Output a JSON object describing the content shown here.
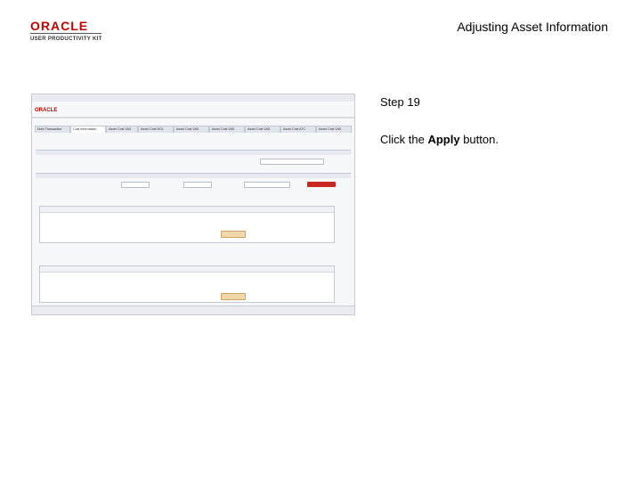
{
  "header": {
    "logo_word": "ORACLE",
    "logo_sub": "USER PRODUCTIVITY KIT",
    "title": "Adjusting Asset Information"
  },
  "step": {
    "label": "Step 19",
    "instruction_prefix": "Click the ",
    "instruction_bold": "Apply",
    "instruction_suffix": " button."
  },
  "screenshot": {
    "brand": "ORACLE",
    "tabs": [
      "Main Transaction",
      "Cost Information",
      "Asset Cost VAS",
      "Asset Cost NOL",
      "Asset Cost VAS",
      "Asset Cost VAS",
      "Asset Cost VAS",
      "Asset Cost ATC",
      "Asset Cost VAS"
    ],
    "apply_label": "Apply"
  },
  "colors": {
    "brand_red": "#c00000",
    "apply_button": "#f2d8a8"
  }
}
